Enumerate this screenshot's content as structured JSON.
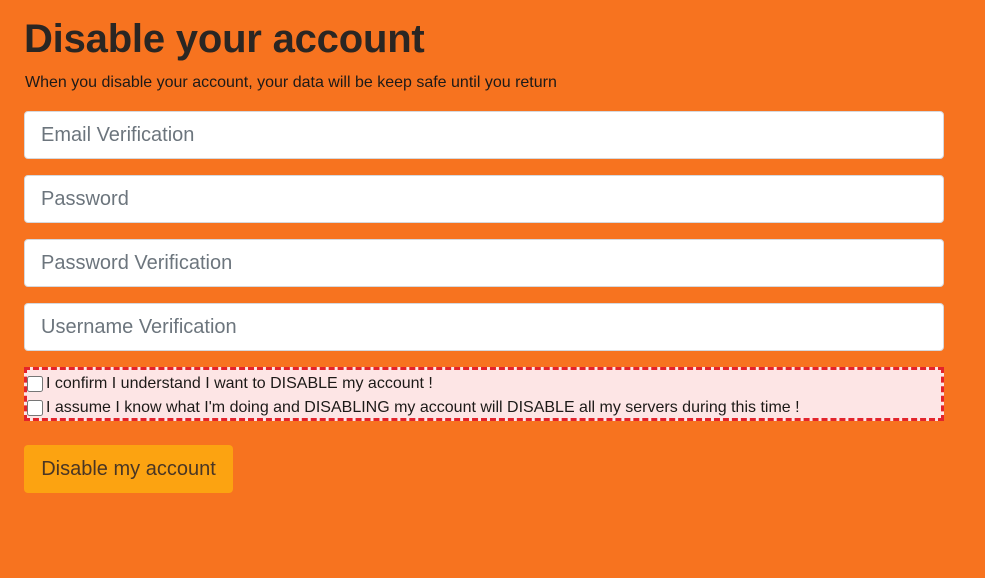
{
  "page": {
    "title": "Disable your account",
    "subtitle": "When you disable your account, your data will be keep safe until you return"
  },
  "form": {
    "email_placeholder": "Email Verification",
    "email_value": "",
    "password_placeholder": "Password",
    "password_value": "",
    "password_verify_placeholder": "Password Verification",
    "password_verify_value": "",
    "username_placeholder": "Username Verification",
    "username_value": "",
    "confirmations": [
      {
        "label": "I confirm I understand I want to DISABLE my account !",
        "checked": false
      },
      {
        "label": "I assume I know what I'm doing and DISABLING my account will DISABLE all my servers during this time !",
        "checked": false
      }
    ],
    "submit_label": "Disable my account"
  },
  "colors": {
    "background": "#f7731f",
    "warning_border": "#e3242b",
    "warning_fill": "#fde5e5",
    "button": "#fca311"
  }
}
